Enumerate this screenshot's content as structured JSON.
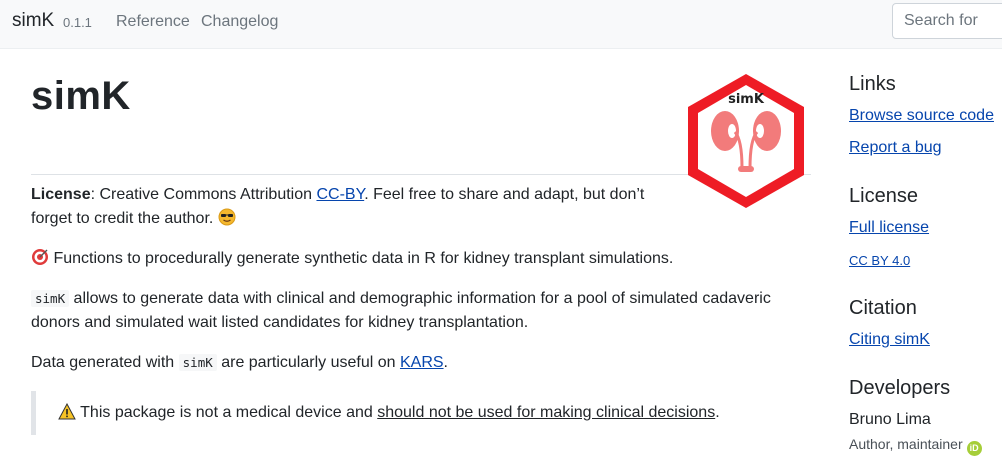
{
  "navbar": {
    "brand": "simK",
    "version": "0.1.1",
    "links": [
      "Reference",
      "Changelog"
    ],
    "search_placeholder": "Search for"
  },
  "main": {
    "title": "simK",
    "logo_text": "simK",
    "license_para": {
      "label": "License",
      "text_before_link": ": Creative Commons Attribution ",
      "link": "CC-BY",
      "text_after_link": ". Feel free to share and adapt, but don’t forget to credit the author."
    },
    "intro_para": "Functions to procedurally generate synthetic data in R for kidney transplant simulations.",
    "description_para": {
      "code": "simK",
      "text": " allows to generate data with clinical and demographic information for a pool of simulated cadaveric donors and simulated wait listed candidates for kidney transplantation."
    },
    "kars_para": {
      "before_code": "Data generated with ",
      "code": "simK",
      "after_code": " are particularly useful on ",
      "link": "KARS",
      "after_link": "."
    },
    "callout": {
      "text_before": "This package is not a medical device and ",
      "underlined": "should not be used for making clinical decisions",
      "text_after": "."
    }
  },
  "sidebar": {
    "links_heading": "Links",
    "links": [
      "Browse source code",
      "Report a bug"
    ],
    "license_heading": "License",
    "license_links": [
      "Full license",
      "CC BY 4.0"
    ],
    "citation_heading": "Citation",
    "citation_link": "Citing simK",
    "developers_heading": "Developers",
    "developer_name": "Bruno Lima",
    "developer_role": "Author, maintainer"
  },
  "colors": {
    "link": "#0645ad",
    "logo_red": "#ee1c25",
    "kidney": "#f27b7b",
    "navbar_bg": "#f8f9fa",
    "orcid": "#a6ce39"
  }
}
